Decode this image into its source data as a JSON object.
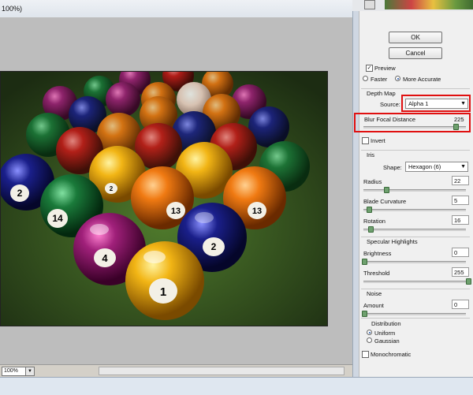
{
  "window": {
    "title_fragment": "100%)"
  },
  "status": {
    "zoom": "100%"
  },
  "buttons": {
    "ok": "OK",
    "cancel": "Cancel"
  },
  "preview": {
    "label": "Preview",
    "checked": true,
    "faster": "Faster",
    "more_accurate": "More Accurate",
    "selected": "more_accurate"
  },
  "depth_map": {
    "title": "Depth Map",
    "source_label": "Source:",
    "source_value": "Alpha 1",
    "blur_label": "Blur Focal Distance",
    "blur_value": "225",
    "blur_level": 0.88,
    "invert_label": "Invert"
  },
  "iris": {
    "title": "Iris",
    "shape_label": "Shape:",
    "shape_value": "Hexagon (6)",
    "radius_label": "Radius",
    "radius_value": "22",
    "curvature_label": "Blade Curvature",
    "curvature_value": "5",
    "rotation_label": "Rotation",
    "rotation_value": "16"
  },
  "specular": {
    "title": "Specular Highlights",
    "brightness_label": "Brightness",
    "brightness_value": "0",
    "threshold_label": "Threshold",
    "threshold_value": "255"
  },
  "noise": {
    "title": "Noise",
    "amount_label": "Amount",
    "amount_value": "0",
    "distribution_label": "Distribution",
    "uniform": "Uniform",
    "gaussian": "Gaussian",
    "selected": "uniform",
    "mono_label": "Monochromatic"
  },
  "photo": {
    "ball_numbers": [
      "2",
      "14",
      "4",
      "13",
      "1",
      "13",
      "2",
      "2"
    ],
    "colors": {
      "yellow": "#f2b515",
      "orange": "#f07a12",
      "blue": "#1a1f8a",
      "purple": "#a0207a",
      "green": "#1a7a3a",
      "red": "#c81818",
      "maroon": "#8a1a2a"
    }
  },
  "colors": {
    "highlight_border": "#e01010",
    "panel_bg": "#f0f0f0"
  }
}
